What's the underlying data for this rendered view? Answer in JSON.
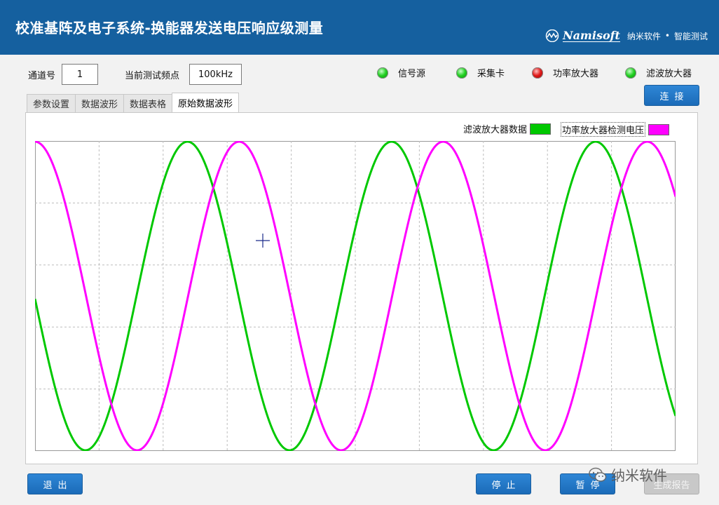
{
  "app": {
    "title": "校准基阵及电子系统-换能器发送电压响应级测量",
    "brand_name": "Namisoft",
    "brand_cn": "纳米软件",
    "brand_sep": "•",
    "brand_tag": "智能测试"
  },
  "params": {
    "channel_label": "通道号",
    "channel_value": "1",
    "freq_label": "当前测试频点",
    "freq_value": "100kHz"
  },
  "indicators": [
    {
      "label": "信号源",
      "status": "green"
    },
    {
      "label": "采集卡",
      "status": "green"
    },
    {
      "label": "功率放大器",
      "status": "red"
    },
    {
      "label": "滤波放大器",
      "status": "green"
    }
  ],
  "connect_button": "连接",
  "tabs": [
    {
      "label": "参数设置",
      "active": false
    },
    {
      "label": "数据波形",
      "active": false
    },
    {
      "label": "数据表格",
      "active": false
    },
    {
      "label": "原始数据波形",
      "active": true
    }
  ],
  "chart_data": {
    "type": "line",
    "series": [
      {
        "name": "滤波放大器数据",
        "color": "#00c800",
        "amplitude": 1.0,
        "period_fraction": 0.3186,
        "phase_fraction": 0.238
      },
      {
        "name": "功率放大器检测电压",
        "color": "#ff00ff",
        "amplitude": 1.0,
        "period_fraction": 0.3186,
        "phase_fraction": 0.0
      }
    ],
    "grid": true,
    "grid_style": "dashed",
    "grid_divisions_x": 10,
    "grid_divisions_y": 5,
    "legend_position": "top-right"
  },
  "buttons": {
    "exit": "退出",
    "stop": "停止",
    "pause": "暂停",
    "report": "生成报告"
  },
  "watermark": "纳米软件"
}
